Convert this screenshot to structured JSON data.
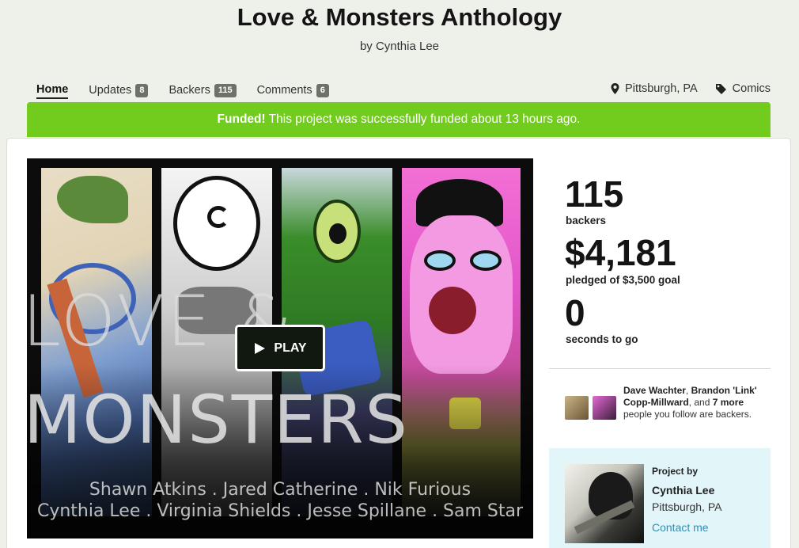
{
  "project": {
    "title": "Love & Monsters Anthology",
    "byline": "by Cynthia Lee"
  },
  "nav": {
    "home": "Home",
    "updates": "Updates",
    "updates_count": "8",
    "backers": "Backers",
    "backers_count": "115",
    "comments": "Comments",
    "comments_count": "6"
  },
  "meta": {
    "location": "Pittsburgh, PA",
    "category": "Comics"
  },
  "funded": {
    "strong": "Funded!",
    "message": "This project was successfully funded about 13 hours ago."
  },
  "video": {
    "play_label": "PLAY",
    "cover_line1": "LOVE &",
    "cover_line2": "MONSTERS",
    "credits_line1": "Shawn Atkins . Jared Catherine . Nik Furious",
    "credits_line2": "Cynthia Lee . Virginia Shields . Jesse Spillane . Sam Star"
  },
  "stats": {
    "backers_value": "115",
    "backers_label": "backers",
    "pledged_value": "$4,181",
    "pledged_label": "pledged of $3,500 goal",
    "time_value": "0",
    "time_label": "seconds to go"
  },
  "friends": {
    "name1": "Dave Wachter",
    "sep1": ", ",
    "name2": "Brandon 'Link' Copp-Millward",
    "sep2": ", and ",
    "more": "7 more",
    "tail": " people you follow are backers."
  },
  "creator": {
    "label": "Project by",
    "name": "Cynthia Lee",
    "location": "Pittsburgh, PA",
    "contact": "Contact me"
  },
  "colors": {
    "funded_green": "#71cc1e",
    "creator_bg": "#e2f6fa",
    "link_blue": "#2e8fb6",
    "count_badge": "#6e7168"
  }
}
